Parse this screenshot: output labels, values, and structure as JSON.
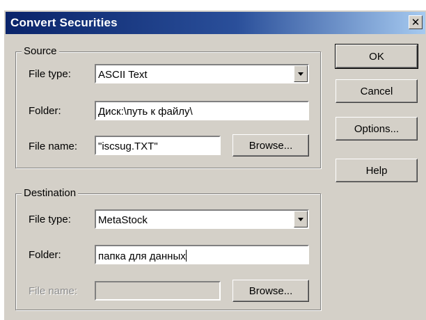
{
  "window": {
    "title": "Convert Securities",
    "close_glyph": "✕"
  },
  "source": {
    "legend": "Source",
    "file_type_label": "File type:",
    "file_type_value": "ASCII Text",
    "folder_label": "Folder:",
    "folder_value": "Диск:\\путь к файлу\\",
    "file_name_label": "File name:",
    "file_name_value": "\"iscsug.TXT\"",
    "browse_label": "Browse..."
  },
  "destination": {
    "legend": "Destination",
    "file_type_label": "File type:",
    "file_type_value": "MetaStock",
    "folder_label": "Folder:",
    "folder_value": "папка для данных",
    "file_name_label": "File name:",
    "file_name_value": "",
    "browse_label": "Browse..."
  },
  "buttons": {
    "ok": "OK",
    "cancel": "Cancel",
    "options": "Options...",
    "help": "Help"
  },
  "icons": {
    "close": "close-icon",
    "dropdown": "chevron-down-icon"
  },
  "colors": {
    "face": "#d4d0c8",
    "titlebar_start": "#0a246a",
    "titlebar_end": "#a6caf0"
  }
}
